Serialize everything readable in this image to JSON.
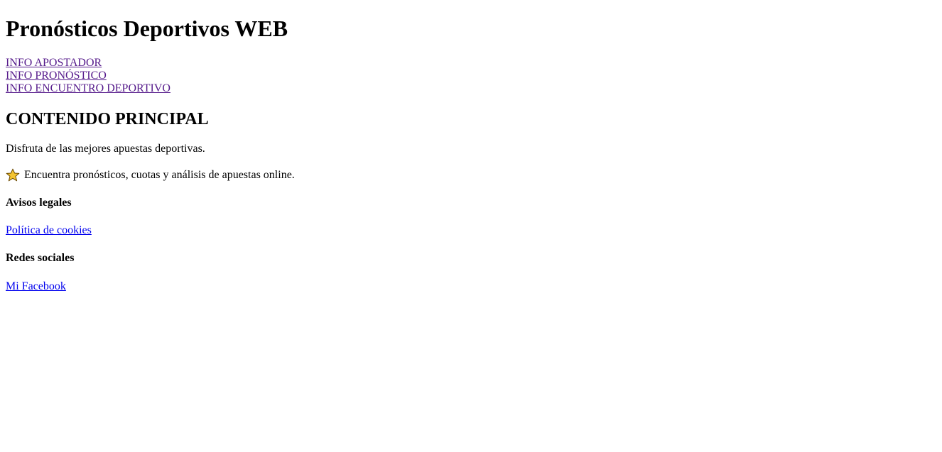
{
  "header": {
    "title": "Pronósticos Deportivos WEB"
  },
  "nav": {
    "items": [
      {
        "label": "INFO APOSTADOR"
      },
      {
        "label": "INFO PRONÓSTICO"
      },
      {
        "label": "INFO ENCUENTRO DEPORTIVO"
      }
    ],
    "visited_color": "#551a8b"
  },
  "main": {
    "heading": "CONTENIDO PRINCIPAL",
    "intro": "Disfruta de las mejores apuestas deportivas.",
    "highlight": {
      "icon": "star-icon",
      "text": "Encuentra pronósticos, cuotas y análisis de apuestas online."
    }
  },
  "footer": {
    "legal": {
      "heading": "Avisos legales",
      "link": "Política de cookies"
    },
    "social": {
      "heading": "Redes sociales",
      "link": "Mi Facebook"
    },
    "link_color": "#0000ee"
  }
}
